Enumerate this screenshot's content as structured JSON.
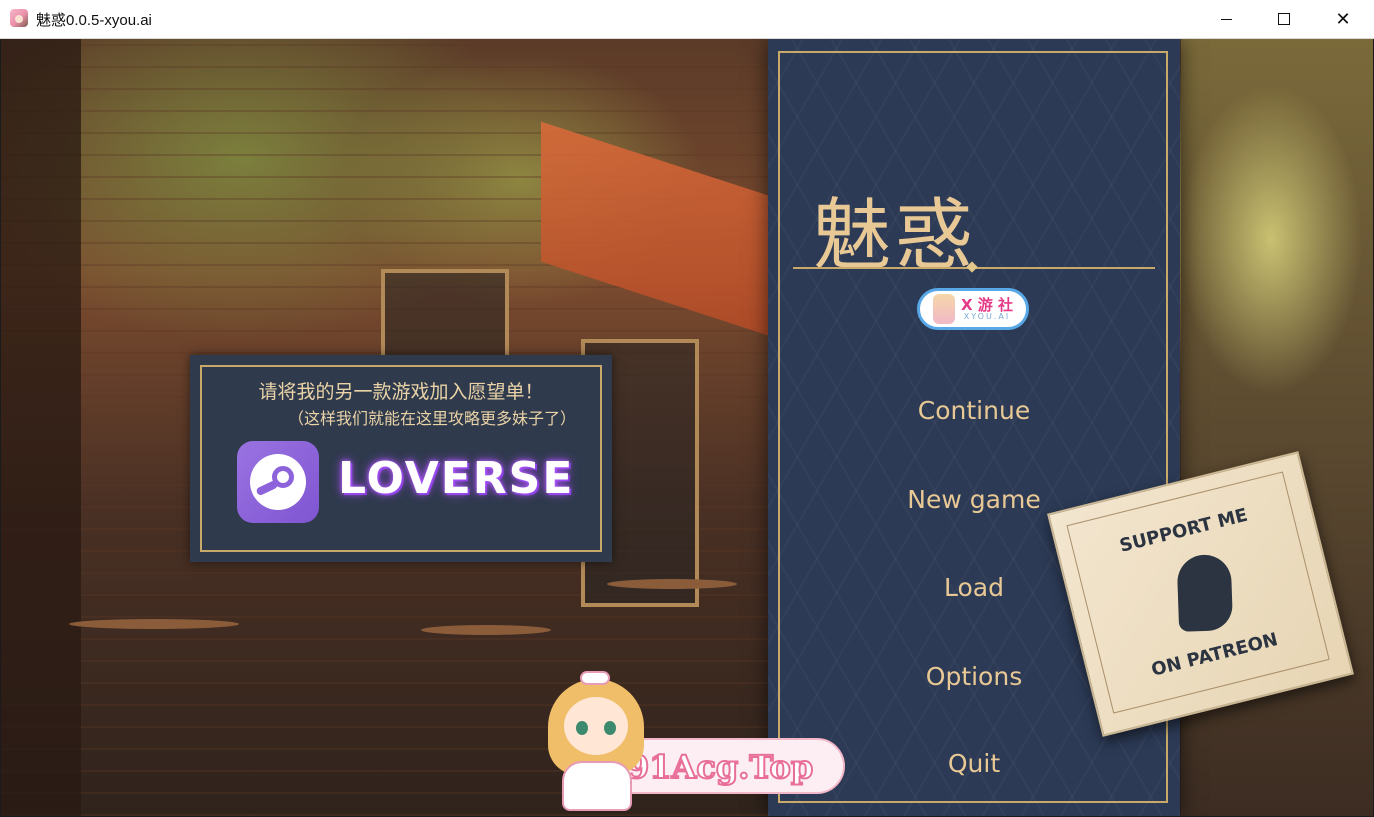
{
  "window": {
    "title": "魅惑0.0.5-xyou.ai",
    "icon": "app-icon",
    "controls": {
      "minimize": "minimize-icon",
      "maximize": "maximize-icon",
      "close": "close-icon"
    },
    "close_glyph": "✕"
  },
  "menu": {
    "game_title": "魅惑",
    "badge": {
      "main": "X 游 社",
      "sub": "XYOU.AI"
    },
    "items": [
      {
        "label": "Continue"
      },
      {
        "label": "New game"
      },
      {
        "label": "Load"
      },
      {
        "label": "Options"
      },
      {
        "label": "Quit"
      }
    ]
  },
  "wishlist": {
    "line1": "请将我的另一款游戏加入愿望单！",
    "line2": "（这样我们就能在这里攻略更多妹子了）",
    "brand": "LOVERSE",
    "icon": "steam-icon"
  },
  "patreon": {
    "top": "SUPPORT ME",
    "bottom": "ON PATREON",
    "icon": "patreon-icon"
  },
  "watermark": {
    "text": "91Acg.Top"
  },
  "colors": {
    "menu_bg": "#2c3a55",
    "gold": "#c9a96a",
    "menu_text": "#e8c894",
    "loverse_glow": "#a94df7"
  }
}
